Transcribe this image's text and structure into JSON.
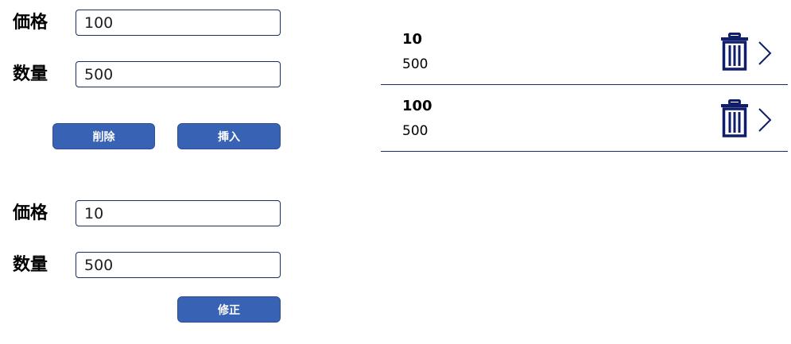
{
  "form_top": {
    "price_label": "価格",
    "price_value": "100",
    "quantity_label": "数量",
    "quantity_value": "500",
    "delete_label": "削除",
    "insert_label": "挿入"
  },
  "form_bottom": {
    "price_label": "価格",
    "price_value": "10",
    "quantity_label": "数量",
    "quantity_value": "500",
    "update_label": "修正"
  },
  "gallery": {
    "items": [
      {
        "title": "10",
        "subtitle": "500"
      },
      {
        "title": "100",
        "subtitle": "500"
      }
    ]
  },
  "icons": {
    "delete": "trash-icon",
    "open": "chevron-right-icon"
  },
  "colors": {
    "accent": "#3862b3",
    "border": "#1c2a6e"
  }
}
